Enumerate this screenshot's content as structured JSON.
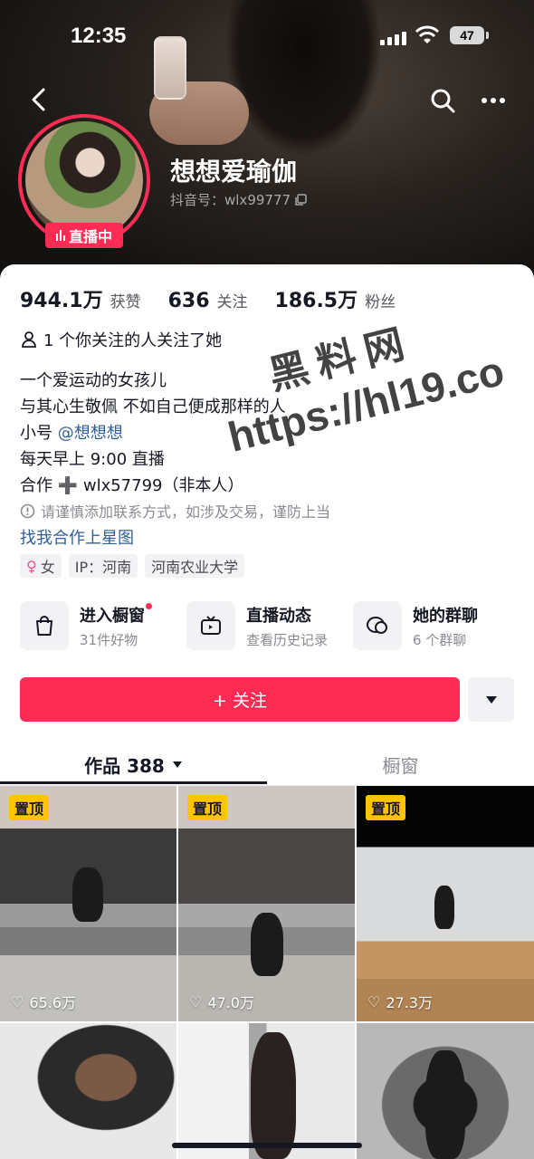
{
  "status_bar": {
    "time": "12:35",
    "battery": "47"
  },
  "profile": {
    "nickname": "想想爱瑜伽",
    "uid": "抖音号：wlx99777",
    "live_badge": "直播中",
    "stats": [
      {
        "value": "944.1万",
        "label": "获赞"
      },
      {
        "value": "636",
        "label": "关注"
      },
      {
        "value": "186.5万",
        "label": "粉丝"
      }
    ],
    "mutual": "1 个你关注的人关注了她",
    "bio": {
      "line1": "一个爱运动的女孩儿",
      "line2": "与其心生敬佩 不如自己便成那样的人",
      "line3_prefix": "小号",
      "line3_mention": "@想想想",
      "line4": "每天早上 9:00 直播",
      "line5": "合作 ➕ wlx57799（非本人）"
    },
    "warning": "请谨慎添加联系方式，如涉及交易，谨防上当",
    "star_link": "找我合作上星图",
    "tags": {
      "gender": "女",
      "ip": "IP：河南",
      "school": "河南农业大学"
    }
  },
  "shortcuts": [
    {
      "title": "进入橱窗",
      "sub": "31件好物",
      "icon": "shopping-bag-icon"
    },
    {
      "title": "直播动态",
      "sub": "查看历史记录",
      "icon": "tv-icon"
    },
    {
      "title": "她的群聊",
      "sub": "6 个群聊",
      "icon": "group-chat-icon"
    }
  ],
  "follow_button": "+ 关注",
  "tabs": {
    "works": "作品 388",
    "showcase": "橱窗"
  },
  "videos": [
    {
      "pinned": "置顶",
      "likes": "65.6万"
    },
    {
      "pinned": "置顶",
      "likes": "47.0万"
    },
    {
      "pinned": "置顶",
      "likes": "27.3万"
    },
    {
      "pinned": "",
      "likes": ""
    },
    {
      "pinned": "",
      "likes": ""
    },
    {
      "pinned": "",
      "likes": ""
    }
  ],
  "watermark": {
    "line1": "黑料网",
    "line2": "https://hl19.co"
  },
  "colors": {
    "accent": "#fe2c55",
    "pin": "#ffc300",
    "link": "#2f5f9a"
  }
}
